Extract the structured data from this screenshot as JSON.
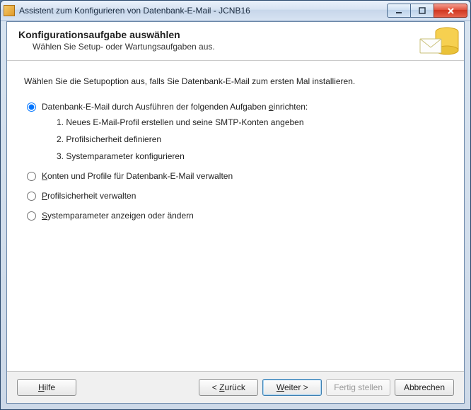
{
  "window": {
    "title": "Assistent zum Konfigurieren von Datenbank-E-Mail - JCNB16"
  },
  "header": {
    "title": "Konfigurationsaufgabe auswählen",
    "subtitle": "Wählen Sie Setup- oder Wartungsaufgaben aus."
  },
  "content": {
    "intro": "Wählen Sie die Setupoption aus, falls Sie Datenbank-E-Mail zum ersten Mal installieren.",
    "options": {
      "setup": {
        "label_pre": "Datenbank-E-Mail durch Ausführen der folgenden Aufgaben ",
        "label_acc": "e",
        "label_post": "inrichten:",
        "selected": true,
        "steps": [
          "1. Neues E-Mail-Profil erstellen und seine SMTP-Konten angeben",
          "2. Profilsicherheit definieren",
          "3. Systemparameter konfigurieren"
        ]
      },
      "manage": {
        "label_acc": "K",
        "label_post": "onten und Profile für Datenbank-E-Mail verwalten",
        "selected": false
      },
      "profile_security": {
        "label_acc": "P",
        "label_post": "rofilsicherheit verwalten",
        "selected": false
      },
      "system_params": {
        "label_acc": "S",
        "label_post": "ystemparameter anzeigen oder ändern",
        "selected": false
      }
    }
  },
  "footer": {
    "help_acc": "H",
    "help_post": "ilfe",
    "back_pre": "< ",
    "back_acc": "Z",
    "back_post": "urück",
    "next_acc": "W",
    "next_post": "eiter >",
    "finish": "Fertig stellen",
    "cancel": "Abbrechen"
  }
}
